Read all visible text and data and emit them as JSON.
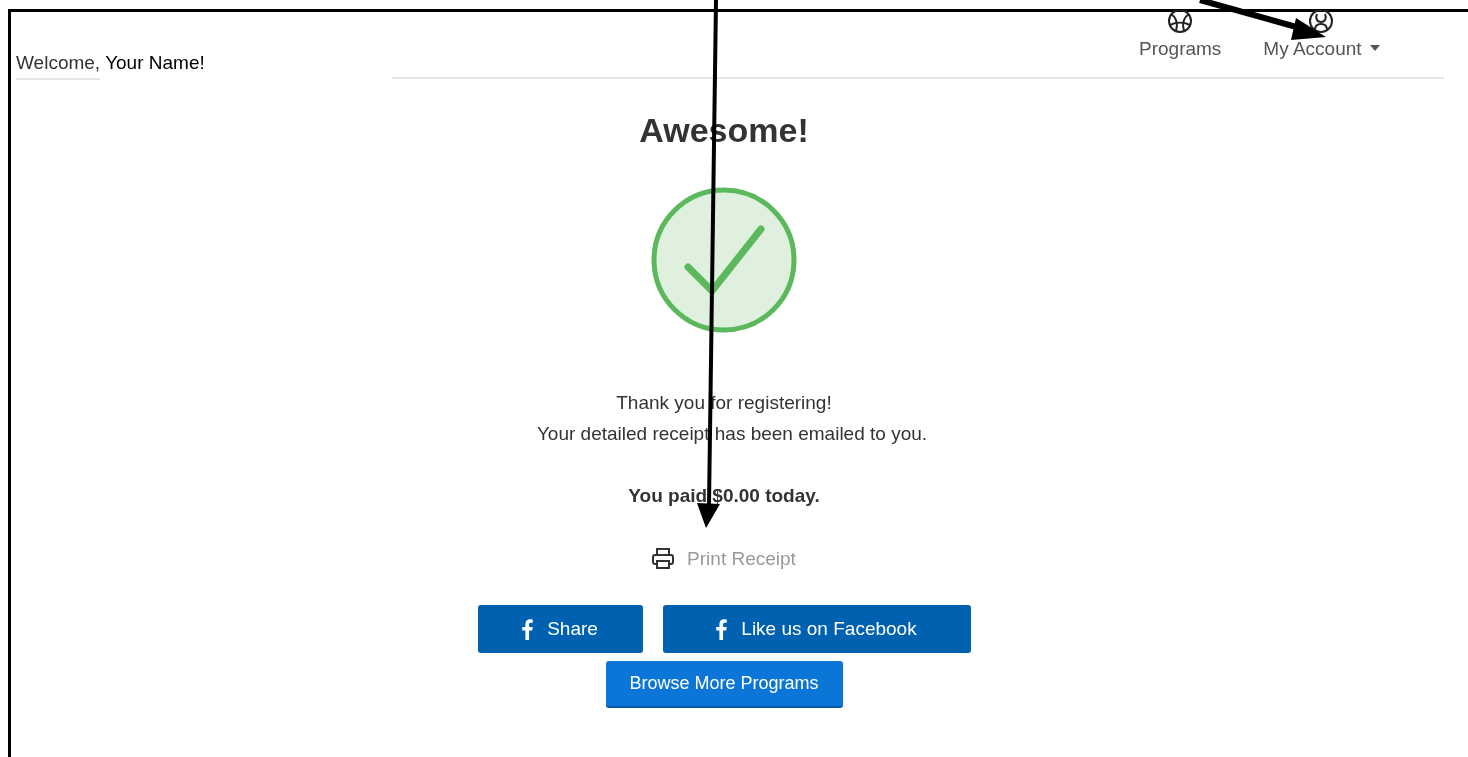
{
  "header": {
    "greeting": "Welcome,",
    "name": "Your Name!"
  },
  "nav": [
    {
      "label": "Programs",
      "kind": "ball",
      "dropdown": false
    },
    {
      "label": "My Account",
      "kind": "person",
      "dropdown": true
    }
  ],
  "heading": "Awesome!",
  "messages": [
    "Thank you for registering!",
    "Your detailed receipt has been emailed to you."
  ],
  "payment": "You paid $0.00 today.",
  "print_link": "Print Receipt",
  "share_buttons": [
    {
      "label": "Share",
      "kind": "facebook"
    },
    {
      "label": "Like us on Facebook",
      "kind": "facebook"
    }
  ],
  "primary_button": "Browse More Programs"
}
